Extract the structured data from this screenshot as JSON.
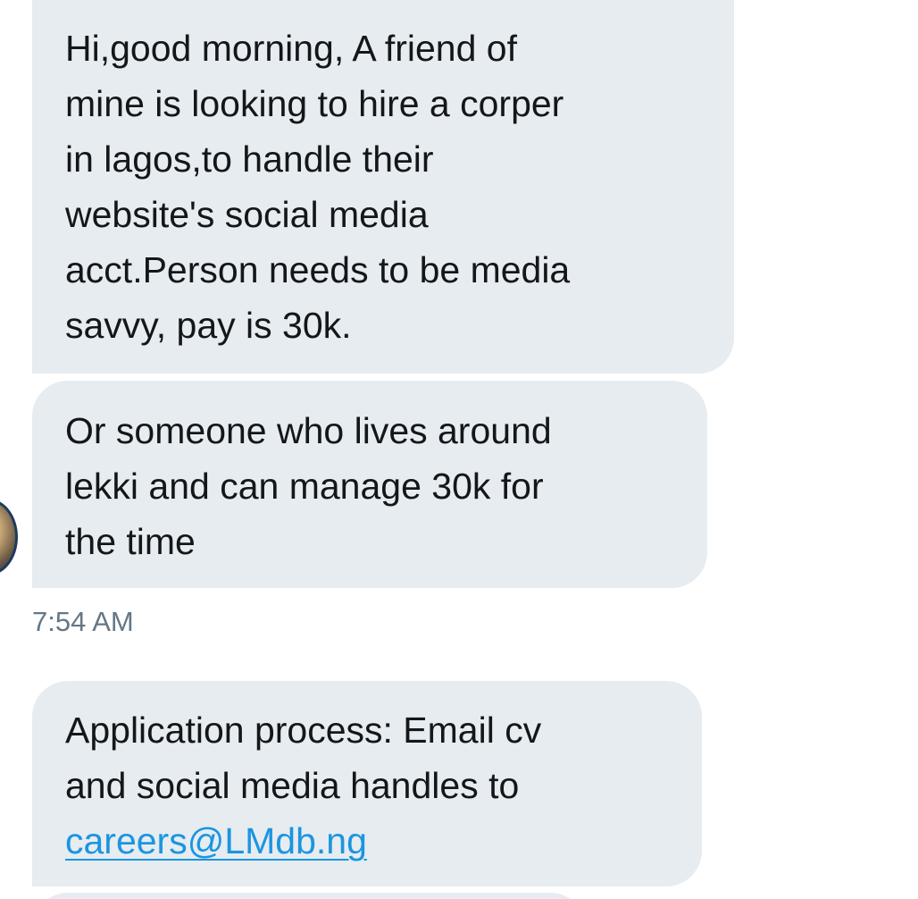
{
  "messages": [
    {
      "text": "Hi,good morning, A friend of\nmine is looking to hire a corper\nin lagos,to handle their\nwebsite's social media\nacct.Person needs to be media\nsavvy, pay is 30k."
    },
    {
      "text": "Or someone who lives around\nlekki and can manage 30k for\nthe time"
    },
    {
      "text_before_link": "Application process: Email cv\nand social media handles to\n",
      "link_text": "careers@LMdb.ng"
    }
  ],
  "timestamp": "7:54 AM",
  "colors": {
    "bubble_background": "#e6ecf0",
    "message_text": "#14171a",
    "link": "#1b95e0",
    "timestamp_text": "#657786"
  }
}
